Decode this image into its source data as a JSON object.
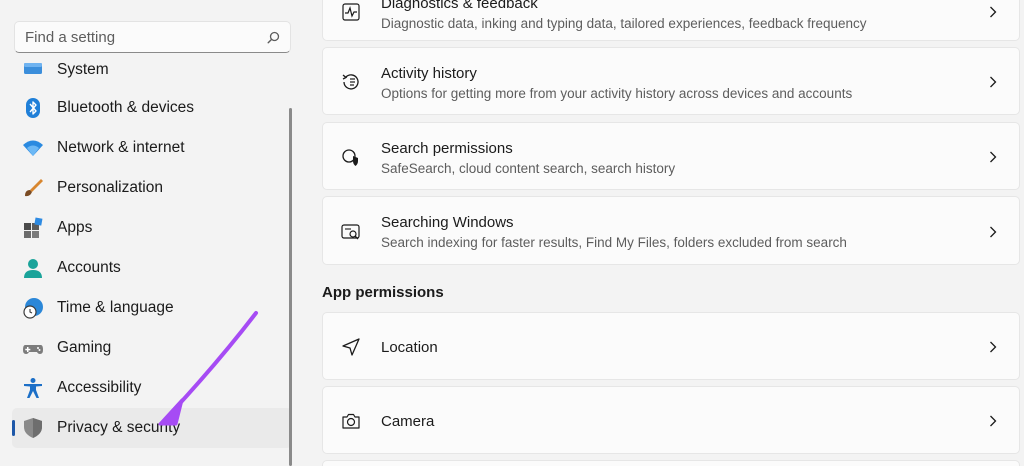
{
  "search": {
    "placeholder": "Find a setting"
  },
  "sidebar": {
    "items": [
      {
        "label": "System",
        "icon": "system-icon"
      },
      {
        "label": "Bluetooth & devices",
        "icon": "bluetooth-icon"
      },
      {
        "label": "Network & internet",
        "icon": "wifi-icon"
      },
      {
        "label": "Personalization",
        "icon": "brush-icon"
      },
      {
        "label": "Apps",
        "icon": "apps-icon"
      },
      {
        "label": "Accounts",
        "icon": "person-icon"
      },
      {
        "label": "Time & language",
        "icon": "globe-clock-icon"
      },
      {
        "label": "Gaming",
        "icon": "gamepad-icon"
      },
      {
        "label": "Accessibility",
        "icon": "accessibility-icon"
      },
      {
        "label": "Privacy & security",
        "icon": "shield-icon",
        "active": true
      }
    ]
  },
  "main": {
    "cards": [
      {
        "title": "Diagnostics & feedback",
        "desc": "Diagnostic data, inking and typing data, tailored experiences, feedback frequency",
        "icon": "diagnostics-icon"
      },
      {
        "title": "Activity history",
        "desc": "Options for getting more from your activity history across devices and accounts",
        "icon": "history-icon"
      },
      {
        "title": "Search permissions",
        "desc": "SafeSearch, cloud content search, search history",
        "icon": "search-shield-icon"
      },
      {
        "title": "Searching Windows",
        "desc": "Search indexing for faster results, Find My Files, folders excluded from search",
        "icon": "search-windows-icon"
      }
    ],
    "section_header": "App permissions",
    "permissions": [
      {
        "title": "Location",
        "icon": "location-icon"
      },
      {
        "title": "Camera",
        "icon": "camera-icon"
      }
    ]
  },
  "colors": {
    "background": "#f3f3f3",
    "card": "#fbfbfb",
    "accent": "#1d57a8",
    "annotation_arrow": "#a64bf4"
  }
}
